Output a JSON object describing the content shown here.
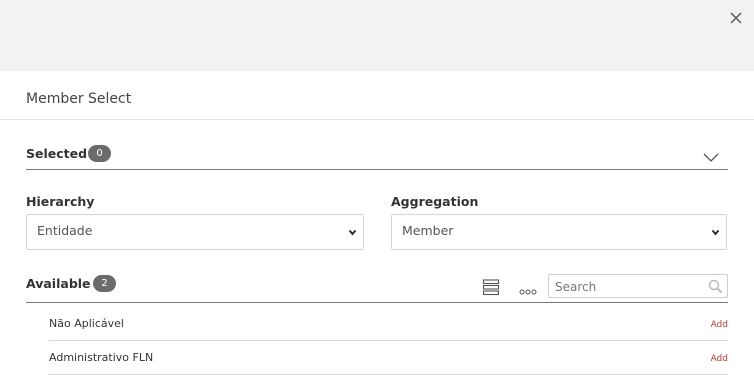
{
  "dialog": {
    "title": "Member Select",
    "close_icon": "close-icon"
  },
  "selected": {
    "label": "Selected",
    "count": "0",
    "toggle_icon": "chevron-down-icon"
  },
  "hierarchy": {
    "label": "Hierarchy",
    "value": "Entidade"
  },
  "aggregation": {
    "label": "Aggregation",
    "value": "Member"
  },
  "available": {
    "label": "Available",
    "count": "2",
    "list_view_icon": "list-view-icon",
    "more_icon": "more-options-icon",
    "search_placeholder": "Search",
    "search_icon": "search-icon",
    "items": [
      {
        "label": "Não Aplicável",
        "action": "Add"
      },
      {
        "label": "Administrativo FLN",
        "action": "Add"
      }
    ]
  },
  "colors": {
    "topbar": "#f2f2f2",
    "badge": "#6b6b6b",
    "add_link": "#c0392b"
  }
}
